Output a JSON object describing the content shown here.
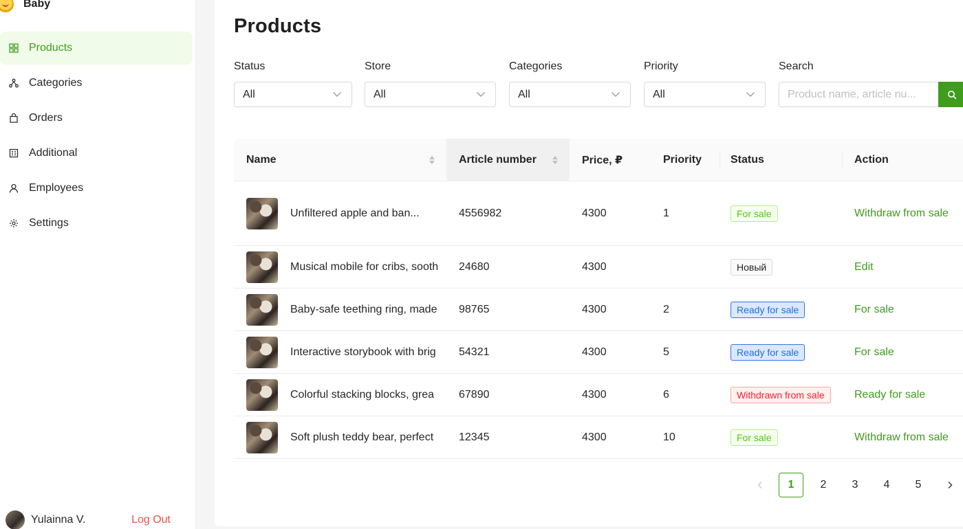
{
  "brand": {
    "name": "Baby"
  },
  "sidebar": {
    "items": [
      {
        "label": "Products",
        "icon": "grid-icon",
        "active": true
      },
      {
        "label": "Categories",
        "icon": "hierarchy-icon",
        "active": false
      },
      {
        "label": "Orders",
        "icon": "shopping-bag-icon",
        "active": false
      },
      {
        "label": "Additional",
        "icon": "building-icon",
        "active": false
      },
      {
        "label": "Employees",
        "icon": "user-icon",
        "active": false
      },
      {
        "label": "Settings",
        "icon": "gear-icon",
        "active": false
      }
    ]
  },
  "user": {
    "name": "Yulainna V.",
    "logout_label": "Log Out"
  },
  "page": {
    "title": "Products"
  },
  "filters": {
    "status": {
      "label": "Status",
      "value": "All"
    },
    "store": {
      "label": "Store",
      "value": "All"
    },
    "categories": {
      "label": "Categories",
      "value": "All"
    },
    "priority": {
      "label": "Priority",
      "value": "All"
    },
    "search": {
      "label": "Search",
      "placeholder": "Product name, article nu..."
    }
  },
  "table": {
    "columns": {
      "name": "Name",
      "article": "Article number",
      "price": "Price, ₽",
      "priority": "Priority",
      "status": "Status",
      "action": "Action"
    },
    "rows": [
      {
        "name": "Unfiltered apple and ban...",
        "article": "4556982",
        "price": "4300",
        "priority": "1",
        "status": "For sale",
        "status_color": "green",
        "action": "Withdraw from sale"
      },
      {
        "name": "Musical mobile for cribs, sooth",
        "article": "24680",
        "price": "4300",
        "priority": "",
        "status": "Новый",
        "status_color": "grey",
        "action": "Edit"
      },
      {
        "name": "Baby-safe teething ring, made",
        "article": "98765",
        "price": "4300",
        "priority": "2",
        "status": "Ready for sale",
        "status_color": "blue",
        "action": "For sale"
      },
      {
        "name": "Interactive storybook with brig",
        "article": "54321",
        "price": "4300",
        "priority": "5",
        "status": "Ready for sale",
        "status_color": "blue",
        "action": "For sale"
      },
      {
        "name": "Colorful stacking blocks, grea",
        "article": "67890",
        "price": "4300",
        "priority": "6",
        "status": "Withdrawn from sale",
        "status_color": "red",
        "action": "Ready for sale"
      },
      {
        "name": "Soft plush teddy bear, perfect",
        "article": "12345",
        "price": "4300",
        "priority": "10",
        "status": "For sale",
        "status_color": "green",
        "action": "Withdraw from sale"
      }
    ]
  },
  "pagination": {
    "pages": [
      "1",
      "2",
      "3",
      "4",
      "5"
    ],
    "current": "1"
  },
  "colors": {
    "accent": "#3f9c1c",
    "active_bg": "#f1fbe9",
    "logout": "#e8544b"
  }
}
